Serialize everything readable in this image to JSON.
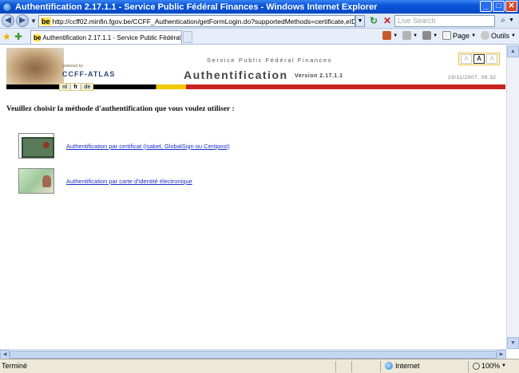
{
  "window": {
    "title": "Authentification 2.17.1.1 - Service Public Fédéral Finances - Windows Internet Explorer",
    "minimize": "_",
    "maximize": "□",
    "close": "✕"
  },
  "address_bar": {
    "favicon": "be",
    "url": "http://ccff02.minfin.fgov.be/CCFF_Authentication/getFormLogin.do?supportedMethods=certificate,eID&forwardContext=/C",
    "search_placeholder": "Live Search"
  },
  "tab": {
    "favicon": "be",
    "label": "Authentification 2.17.1.1 - Service Public Fédéral Fina..."
  },
  "toolbar": {
    "page_label": "Page",
    "tools_label": "Outils"
  },
  "header": {
    "powered_by": "powered by",
    "brand": "CCFF-ATLAS",
    "service": "Service Public Fédéral Finances",
    "title": "Authentification",
    "version": "Version 2.17.1.1",
    "datetime": "19/11/2007, 09:32",
    "font_sizes": [
      "A",
      "A",
      "A"
    ],
    "languages": [
      "nl",
      "fr",
      "de"
    ],
    "active_language": "fr"
  },
  "main": {
    "prompt": "Veuillez choisir la méthode d'authentification que vous voulez utiliser :",
    "methods": [
      {
        "label": "Authentification par certificat (Isabel, GlobalSign ou Certipost)"
      },
      {
        "label": "Authentification par carte d'identité électronique"
      }
    ]
  },
  "status_bar": {
    "status": "Terminé",
    "zone": "Internet",
    "zoom": "100%"
  },
  "colors": {
    "titlebar": "#0a55d8",
    "link": "#1a2ecc",
    "ribbon_black": "#000000",
    "ribbon_yellow": "#f0c800",
    "ribbon_red": "#c8231e"
  }
}
